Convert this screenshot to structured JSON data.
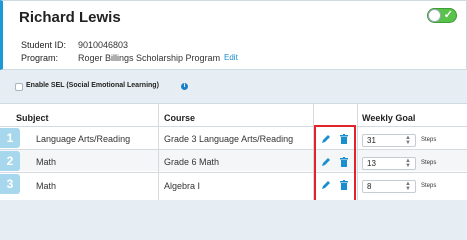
{
  "student": {
    "name": "Richard Lewis",
    "student_id_label": "Student ID:",
    "student_id": "9010046803",
    "program_label": "Program:",
    "program": "Roger Billings Scholarship Program",
    "edit_label": "Edit",
    "toggle_on": true
  },
  "sel": {
    "label": "Enable SEL (Social Emotional Learning)",
    "checked": false,
    "info_icon": "i"
  },
  "table": {
    "headers": {
      "subject": "Subject",
      "course": "Course",
      "goal": "Weekly Goal"
    },
    "rows": [
      {
        "num": "1",
        "subject": "Language Arts/Reading",
        "course": "Grade 3 Language Arts/Reading",
        "goal": "31",
        "unit": "Steps"
      },
      {
        "num": "2",
        "subject": "Math",
        "course": "Grade 6 Math",
        "goal": "13",
        "unit": "Steps"
      },
      {
        "num": "3",
        "subject": "Math",
        "course": "Algebra I",
        "goal": "8",
        "unit": "Steps"
      }
    ]
  },
  "colors": {
    "accent": "#1a9ad6",
    "toggle_on": "#58c24a",
    "highlight": "#e2232a",
    "row_number_bg": "#a7d7ec"
  },
  "icons": {
    "edit": "pencil-icon",
    "delete": "trash-icon"
  }
}
